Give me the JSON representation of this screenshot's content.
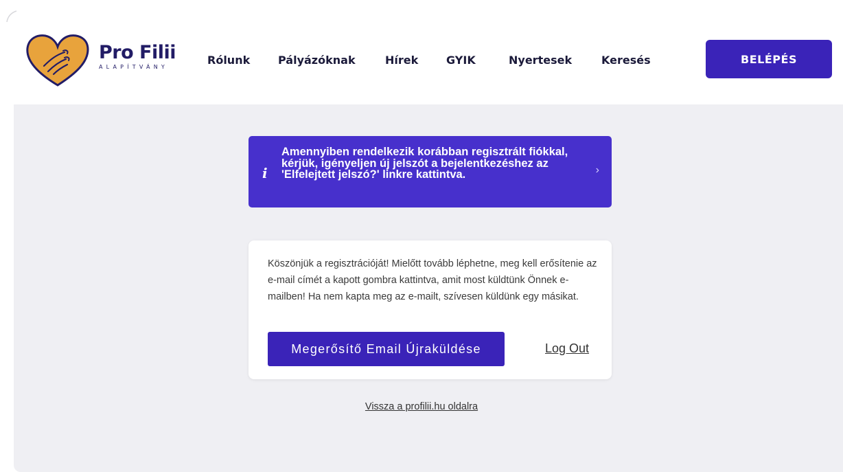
{
  "brand": {
    "name": "Pro Filii",
    "subtitle": "ALAPÍTVÁNY",
    "colors": {
      "primary": "#3a23b8",
      "info_banner": "#4730cc",
      "logo_heart": "#e8a33c",
      "logo_outline": "#221c66"
    }
  },
  "nav": {
    "items": [
      "Rólunk",
      "Pályázóknak",
      "Hírek",
      "GYIK",
      "Nyertesek",
      "Keresés"
    ],
    "login_label": "BELÉPÉS"
  },
  "info_banner": {
    "icon": "info-icon",
    "text": "Amennyiben rendelkezik korábban regisztrált fiókkal, kérjük, igényeljen új jelszót a bejelentkezéshez az 'Elfelejtett jelszó?' linkre kattintva.",
    "chevron": "›"
  },
  "verify_card": {
    "message": "Köszönjük a regisztrációját! Mielőtt tovább léphetne, meg kell erősítenie az e-mail címét a kapott gombra kattintva, amit most küldtünk Önnek e-mailben! Ha nem kapta meg az e-mailt, szívesen küldünk egy másikat.",
    "resend_label": "Megerősítő Email Újraküldése",
    "logout_label": "Log Out"
  },
  "back_link": "Vissza a profilii.hu oldalra"
}
